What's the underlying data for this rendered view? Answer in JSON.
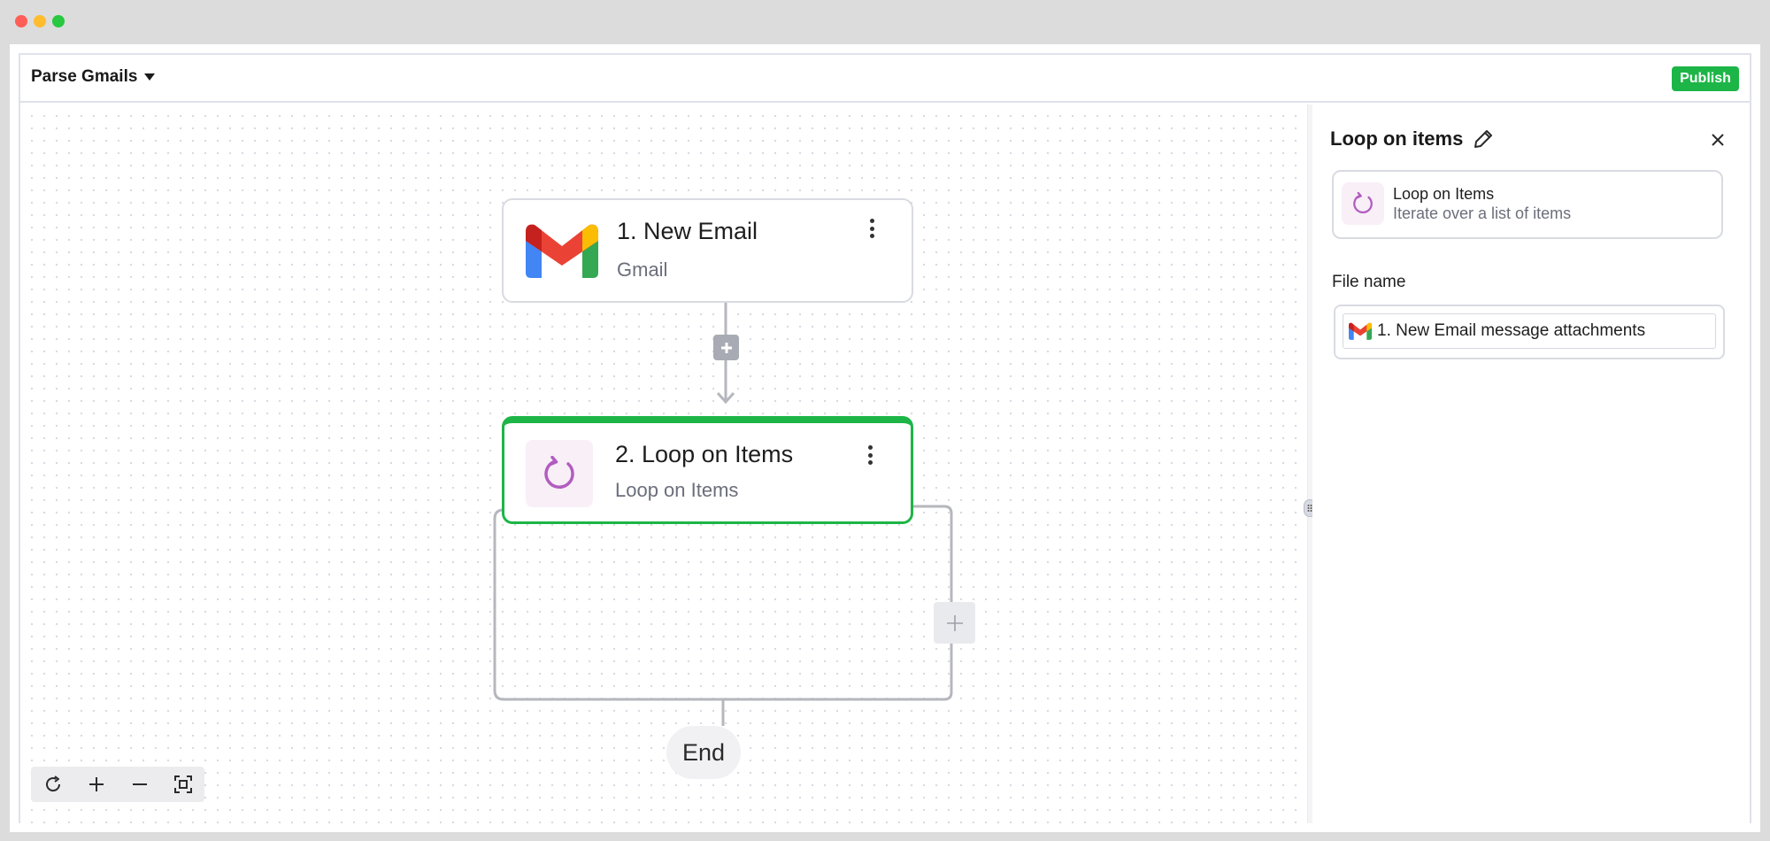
{
  "app": {
    "flow_name": "Parse Gmails",
    "publish_label": "Publish"
  },
  "canvas": {
    "steps": [
      {
        "title": "1. New Email",
        "subtitle": "Gmail",
        "icon": "gmail-logo-icon",
        "selected": false
      },
      {
        "title": "2. Loop on Items",
        "subtitle": "Loop on Items",
        "icon": "loop-icon",
        "selected": true
      }
    ],
    "end_label": "End",
    "tools": [
      "refresh-icon",
      "zoom-in-icon",
      "zoom-out-icon",
      "fit-view-icon"
    ]
  },
  "panel": {
    "title": "Loop on items",
    "piece": {
      "name": "Loop on Items",
      "description": "Iterate over a list of items"
    },
    "field": {
      "label": "File name",
      "token_text": "1. New Email message attachments"
    }
  },
  "colors": {
    "accent_green": "#1db547",
    "loop_purple": "#b25cc0",
    "border": "#d9dbe2"
  }
}
